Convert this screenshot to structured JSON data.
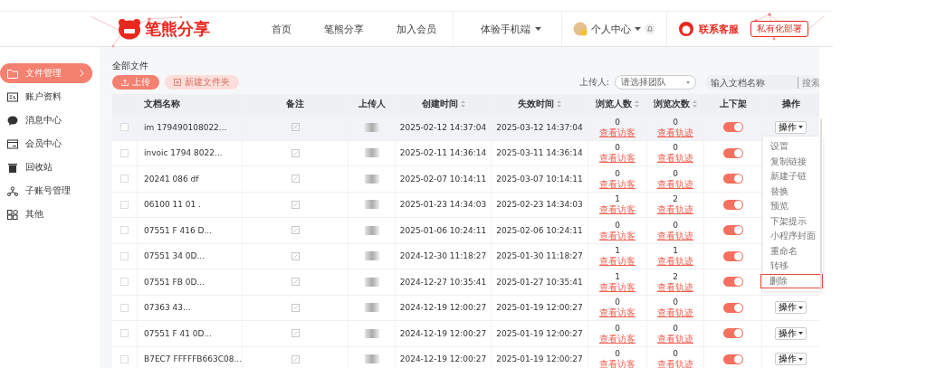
{
  "header": {
    "logo": "笔熊分享",
    "nav": [
      {
        "label": "首页",
        "dropdown": false
      },
      {
        "label": "笔熊分享",
        "dropdown": false
      },
      {
        "label": "加入会员",
        "dropdown": false
      },
      {
        "label": "体验手机端",
        "dropdown": true
      }
    ],
    "user": "个人中心",
    "service": "联系客服",
    "tag": "私有化部署"
  },
  "sidebar": {
    "items": [
      {
        "label": "文件管理",
        "selected": true
      },
      {
        "label": "账户资料",
        "selected": false
      },
      {
        "label": "消息中心",
        "selected": false
      },
      {
        "label": "会员中心",
        "selected": false
      },
      {
        "label": "回收站",
        "selected": false
      },
      {
        "label": "子账号管理",
        "selected": false
      },
      {
        "label": "其他",
        "selected": false
      }
    ]
  },
  "breadcrumb": "全部文件",
  "buttons": [
    {
      "label": "上传",
      "disabled": false
    },
    {
      "label": "新建文件夹",
      "disabled": true
    }
  ],
  "filter": {
    "label": "上传人:",
    "select_placeholder": "请选择团队",
    "search_placeholder": "输入文档名称",
    "search_button": "搜索"
  },
  "table": {
    "columns": [
      {
        "label": "文档名称",
        "sortable": false
      },
      {
        "label": "备注",
        "sortable": false
      },
      {
        "label": "上传人",
        "sortable": false
      },
      {
        "label": "创建时间",
        "sortable": true
      },
      {
        "label": "失效时间",
        "sortable": true
      },
      {
        "label": "浏览人数",
        "sortable": true
      },
      {
        "label": "浏览次数",
        "sortable": true
      },
      {
        "label": "上下架",
        "sortable": false
      },
      {
        "label": "操作",
        "sortable": false
      }
    ],
    "rows": [
      {
        "name": "im 179490108022...",
        "uploader_blurred": true,
        "created": "2025-02-12 14:37:04",
        "expires": "2025-03-12 14:37:04",
        "visitors": "0",
        "visitors_link": "查看访客",
        "visits": "0",
        "visits_link": "查看轨迹",
        "on": true,
        "hover": true,
        "action": "操作"
      },
      {
        "name": "invoic 1794 8022...",
        "uploader_blurred": true,
        "created": "2025-02-11 14:36:14",
        "expires": "2025-03-11 14:36:14",
        "visitors": "0",
        "visitors_link": "查看访客",
        "visits": "0",
        "visits_link": "查看轨迹",
        "on": true,
        "hover": false
      },
      {
        "name": "20241 086 df",
        "uploader_blurred": true,
        "created": "2025-02-07 10:14:11",
        "expires": "2025-03-07 10:14:11",
        "visitors": "0",
        "visitors_link": "查看访客",
        "visits": "0",
        "visits_link": "查看轨迹",
        "on": true,
        "hover": false
      },
      {
        "name": "06100 11 01 .",
        "uploader_blurred": true,
        "created": "2025-01-23 14:34:03",
        "expires": "2025-02-23 14:34:03",
        "visitors": "1",
        "visitors_link": "查看访客",
        "visits": "2",
        "visits_link": "查看轨迹",
        "on": true,
        "hover": false
      },
      {
        "name": "07551 F 416 D...",
        "uploader_blurred": true,
        "created": "2025-01-06 10:24:11",
        "expires": "2025-02-06 10:24:11",
        "visitors": "0",
        "visitors_link": "查看访客",
        "visits": "0",
        "visits_link": "查看轨迹",
        "on": true,
        "hover": false
      },
      {
        "name": "07551 34 0D...",
        "uploader_blurred": true,
        "created": "2024-12-30 11:18:27",
        "expires": "2025-01-30 11:18:27",
        "visitors": "1",
        "visitors_link": "查看访客",
        "visits": "1",
        "visits_link": "查看轨迹",
        "on": true,
        "hover": false
      },
      {
        "name": "07551 FB 0D...",
        "uploader_blurred": true,
        "created": "2024-12-27 10:35:41",
        "expires": "2025-01-27 10:35:41",
        "visitors": "1",
        "visitors_link": "查看访客",
        "visits": "2",
        "visits_link": "查看轨迹",
        "on": true,
        "hover": false
      },
      {
        "name": "07363 43...",
        "uploader_blurred": true,
        "created": "2024-12-19 12:00:27",
        "expires": "2025-01-19 12:00:27",
        "visitors": "0",
        "visitors_link": "查看访客",
        "visits": "0",
        "visits_link": "查看轨迹",
        "on": true,
        "hover": false,
        "action": "操作"
      },
      {
        "name": "07551 F 41 0D...",
        "uploader_blurred": true,
        "created": "2024-12-19 12:00:27",
        "expires": "2025-01-19 12:00:27",
        "visitors": "0",
        "visitors_link": "查看访客",
        "visits": "0",
        "visits_link": "查看轨迹",
        "on": true,
        "hover": false,
        "action": "操作"
      },
      {
        "name": "B7EC7 FFFFFB663C08...",
        "uploader_blurred": true,
        "created": "2024-12-19 12:00:27",
        "expires": "2025-01-19 12:00:27",
        "visitors": "0",
        "visitors_link": "查看访客",
        "visits": "0",
        "visits_link": "查看轨迹",
        "on": true,
        "hover": false,
        "action": "操作"
      }
    ]
  },
  "action_menu": {
    "items": [
      {
        "label": "设置",
        "boxed": false
      },
      {
        "label": "复制链接",
        "boxed": false
      },
      {
        "label": "新建子链",
        "boxed": false
      },
      {
        "label": "替换",
        "boxed": false
      },
      {
        "label": "预览",
        "boxed": false
      },
      {
        "label": "下架提示",
        "boxed": false
      },
      {
        "label": "小程序封面",
        "boxed": false
      },
      {
        "label": "重命名",
        "boxed": false
      },
      {
        "label": "转移",
        "boxed": false
      },
      {
        "label": "删除",
        "boxed": true
      }
    ]
  }
}
